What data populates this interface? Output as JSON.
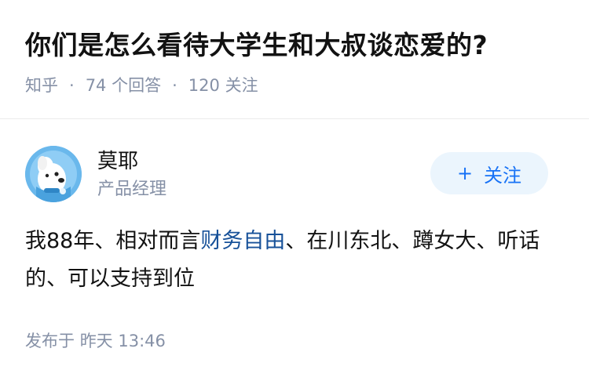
{
  "question": {
    "title": "你们是怎么看待大学生和大叔谈恋爱的?",
    "source": "知乎",
    "separator": "·",
    "answers_count": "74",
    "answers_label": "个回答",
    "followers_count": "120",
    "followers_label": "关注"
  },
  "author": {
    "name": "莫耶",
    "title": "产品经理",
    "avatar_icon": "dog-avatar-icon",
    "follow_label": "关注",
    "follow_plus": "+"
  },
  "answer": {
    "text_before_link": "我88年、相对而言",
    "link_text": "财务自由",
    "text_after_link": "、在川东北、蹲女大、听话的、可以支持到位",
    "link_color": "#175199"
  },
  "footer": {
    "publish_label": "发布于",
    "publish_time": "昨天 13:46"
  },
  "colors": {
    "meta_gray": "#8590a6",
    "follow_bg": "#ebf5fd",
    "follow_text": "#1772f6",
    "avatar_bg": "#6ab8ec"
  }
}
